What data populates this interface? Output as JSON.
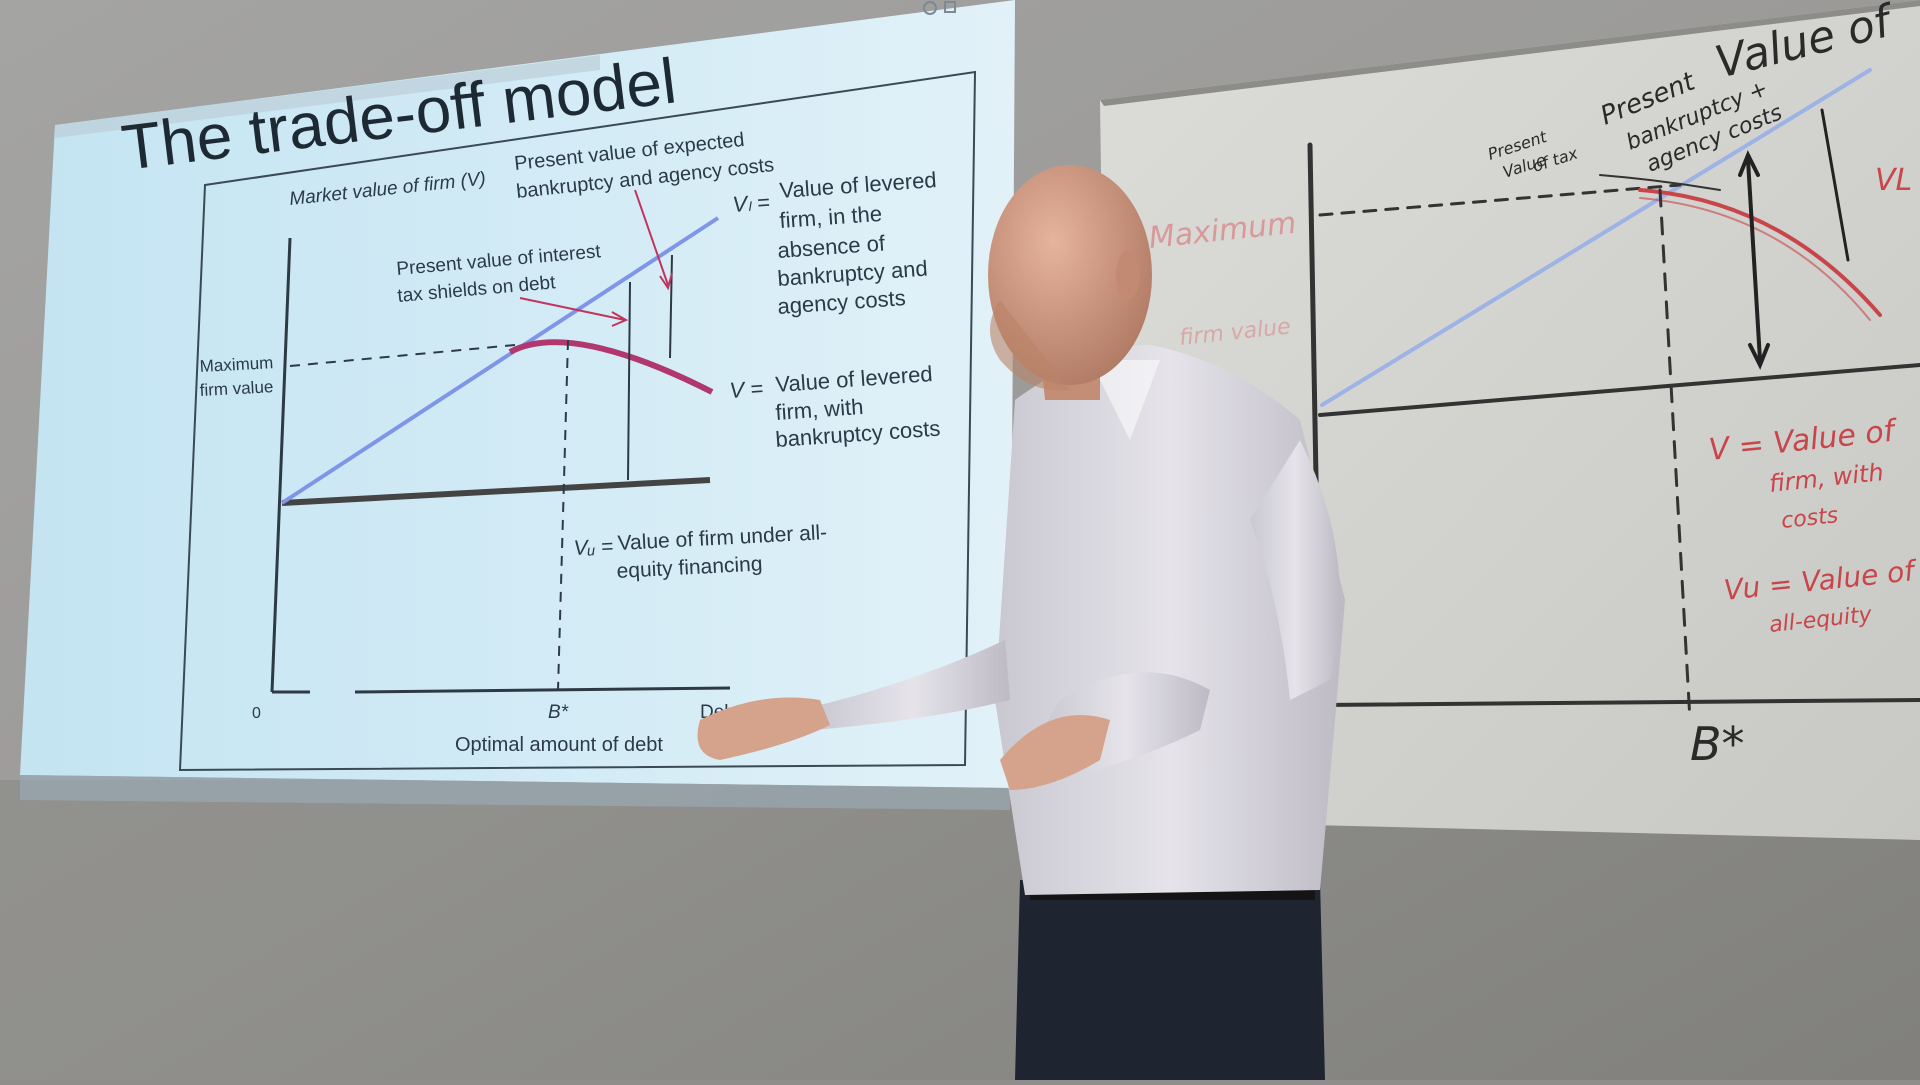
{
  "slide": {
    "title": "The trade-off model",
    "y_axis_label": "Market value of firm (V)",
    "pv_bankruptcy_line1": "Present value of expected",
    "pv_bankruptcy_line2": "bankruptcy and agency costs",
    "pv_tax_line1": "Present value of interest",
    "pv_tax_line2": "tax shields on debt",
    "max_value_line1": "Maximum",
    "max_value_line2": "firm value",
    "vl_symbol": "Vₗ =",
    "vl_lines": [
      "Value of levered",
      "firm, in the",
      "absence of",
      "bankruptcy and",
      "agency costs"
    ],
    "v_symbol": "V =",
    "v_lines": [
      "Value of levered",
      "firm, with",
      "bankruptcy costs"
    ],
    "vu_symbol": "Vᵤ =",
    "vu_lines": [
      "Value of firm under all-",
      "equity financing"
    ],
    "x_origin": "0",
    "x_bstar": "B*",
    "x_end": "Debt",
    "x_axis_label": "Optimal amount of debt"
  },
  "whiteboard": {
    "top_right_1": "Value of",
    "top_right_2": "Present",
    "top_right_3": "bankruptcy +",
    "top_right_4": "agency costs",
    "small_1": "Present",
    "small_2": "Value",
    "small_3": "of tax",
    "red_left": "Maximum",
    "red_left_2": "firm value",
    "v_note_1": "V = Value of",
    "v_note_2": "firm, with",
    "v_note_3": "costs",
    "vu_note_1": "Vu = Value of",
    "vu_note_2": "all-equity",
    "vl_note": "VL",
    "bstar": "B*"
  },
  "colors": {
    "slide_bg": "#cfe9f4",
    "line_blue": "#7f95e8",
    "curve_red": "#b0386f",
    "marker_red": "#c8454a",
    "marker_black": "#2a2a2a"
  }
}
